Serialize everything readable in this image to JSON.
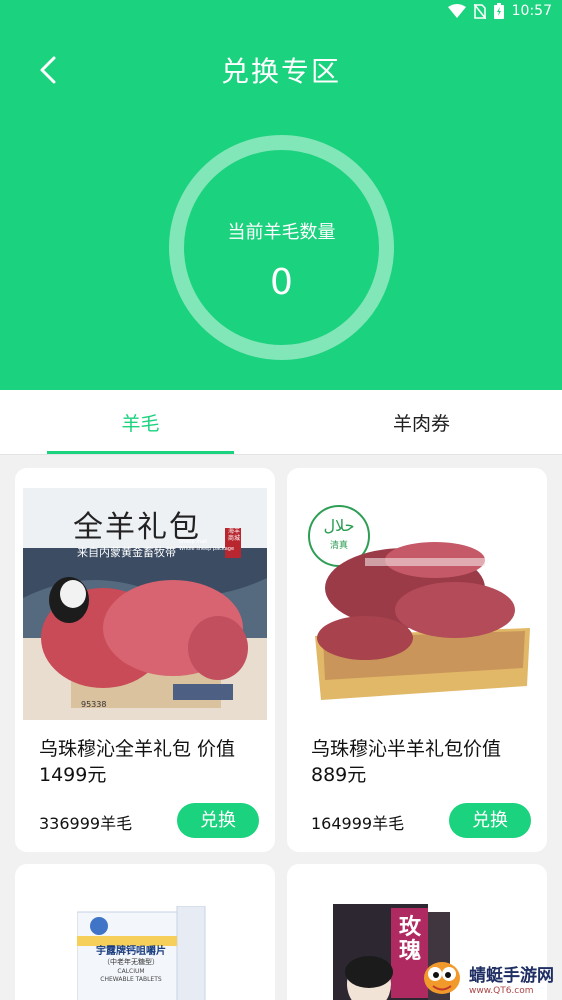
{
  "status_bar": {
    "time": "10:57"
  },
  "header": {
    "title": "兑换专区",
    "counter_label": "当前羊毛数量",
    "counter_value": "0"
  },
  "tabs": [
    {
      "label": "羊毛",
      "active": true
    },
    {
      "label": "羊肉券",
      "active": false
    }
  ],
  "products": [
    {
      "name": "乌珠穆沁全羊礼包 价值1499元",
      "price": "336999羊毛",
      "button": "兑换",
      "image": {
        "headline": "全羊礼包",
        "sub": "来自内蒙黄金畜牧带",
        "sub_en": "Sheep mall\nWhole sheep package",
        "stamp": "海羊商城",
        "box_code": "95338"
      }
    },
    {
      "name": "乌珠穆沁半羊礼包价值889元",
      "price": "164999羊毛",
      "button": "兑换",
      "image": {
        "logo_text": "حلال",
        "logo_sub": "清真"
      }
    }
  ],
  "partial_products": [
    {
      "image": {
        "title": "宇露牌钙咀嚼片",
        "sub": "（中老年无糖型）",
        "en": "CALCIUM\nCHEWABLE TABLETS"
      }
    },
    {
      "image": {
        "title": "玫瑰"
      }
    }
  ],
  "watermark": {
    "name": "蜻蜓手游网",
    "url": "www.QT6.com"
  },
  "colors": {
    "primary": "#1bd27e",
    "background": "#f1f1f1"
  }
}
